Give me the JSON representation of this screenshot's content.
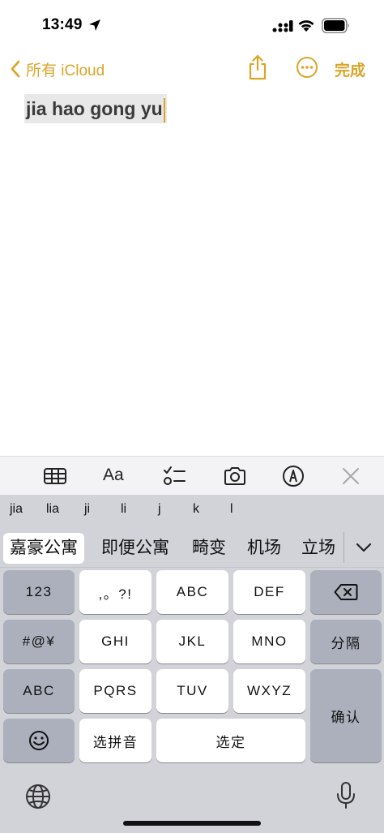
{
  "status_bar": {
    "time": "13:49",
    "icons": [
      "location-arrow-icon",
      "cellular-signal-icon",
      "wifi-icon",
      "battery-icon"
    ]
  },
  "nav": {
    "back_label": "所有 iCloud",
    "done_label": "完成",
    "accent_color": "#d9a52a"
  },
  "note": {
    "text": "jia hao gong yu"
  },
  "toolbar": {
    "icons": [
      "table-icon",
      "text-format-icon",
      "checklist-icon",
      "camera-icon",
      "markup-pen-icon",
      "close-icon"
    ],
    "format_label": "Aa"
  },
  "keyboard": {
    "pinyin": [
      "jia",
      "lia",
      "ji",
      "li",
      "j",
      "k",
      "l"
    ],
    "candidates": [
      "嘉豪公寓",
      "即便公寓",
      "畸变",
      "机场",
      "立场"
    ],
    "keys": {
      "num": "123",
      "punct": ",。?!",
      "abc": "ABC",
      "def": "DEF",
      "symbols": "#@¥",
      "ghi": "GHI",
      "jkl": "JKL",
      "mno": "MNO",
      "separator": "分隔",
      "abc_switch": "ABC",
      "pqrs": "PQRS",
      "tuv": "TUV",
      "wxyz": "WXYZ",
      "confirm": "确认",
      "select_pinyin": "选拼音",
      "select": "选定"
    }
  }
}
